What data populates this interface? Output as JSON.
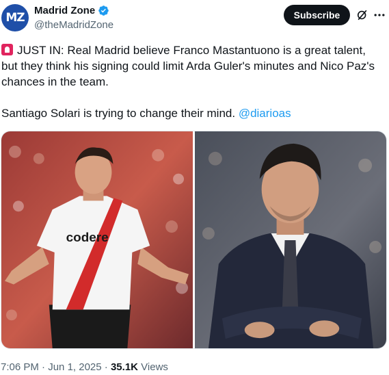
{
  "author": {
    "avatar_text": "MZ",
    "display_name": "Madrid Zone",
    "handle": "@theMadridZone",
    "verified": true
  },
  "actions": {
    "subscribe_label": "Subscribe",
    "grok_icon": "grok-icon",
    "more_icon": "more-icon"
  },
  "tweet": {
    "line1_text": "JUST IN: Real Madrid believe Franco Mastantuono is a great talent, but they think his signing could limit Arda Guler's minutes and Nico Paz's chances in the team.",
    "line2_text": "Santiago Solari is trying to change their mind. ",
    "mention": "@diarioas",
    "alarm_icon": "police-light-icon"
  },
  "media": {
    "photo1": {
      "sponsor_text": "codere",
      "alt": "photo-player-red-white-kit"
    },
    "photo2": {
      "alt": "photo-man-suit-arms-crossed"
    }
  },
  "meta": {
    "time": "7:06 PM",
    "separator": " · ",
    "date": "Jun 1, 2025",
    "views_count": "35.1K",
    "views_label": " Views"
  },
  "colors": {
    "accent": "#1d9bf0",
    "text": "#0f1419",
    "muted": "#536471",
    "avatar_bg": "#1f4fa8",
    "subscribe_bg": "#0f1419"
  }
}
